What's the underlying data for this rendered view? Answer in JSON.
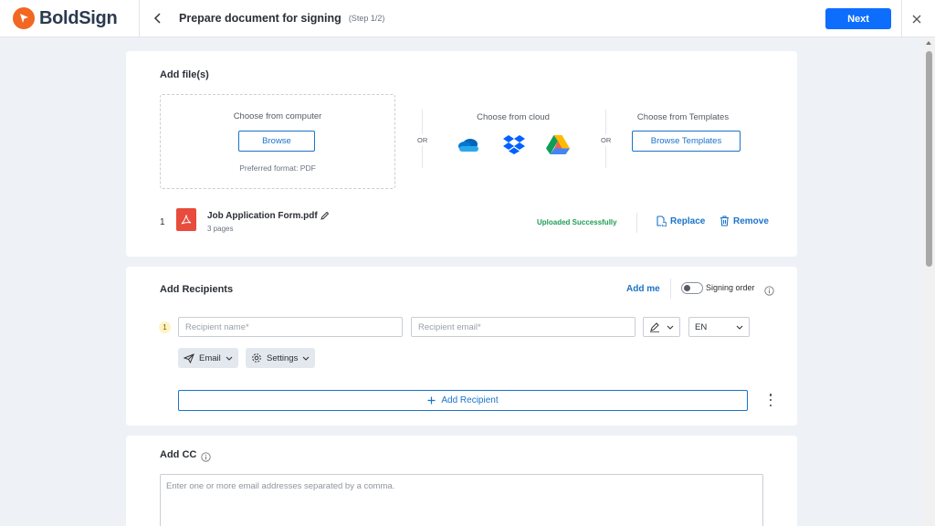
{
  "app": {
    "name": "BoldSign",
    "brand_color": "#f26722",
    "accent_color": "#1a73c9"
  },
  "header": {
    "title": "Prepare document for signing",
    "step": "(Step 1/2)",
    "next_label": "Next"
  },
  "add_files": {
    "title": "Add file(s)",
    "computer": {
      "label": "Choose from computer",
      "button": "Browse",
      "format": "Preferred format: PDF"
    },
    "or_label": "OR",
    "cloud": {
      "label": "Choose from cloud",
      "icons": [
        "onedrive-icon",
        "dropbox-icon",
        "google-drive-icon"
      ]
    },
    "templates": {
      "label": "Choose from Templates",
      "button": "Browse Templates"
    },
    "file": {
      "index": "1",
      "name": "Job Application Form.pdf",
      "pages": "3 pages",
      "status": "Uploaded Successfully",
      "replace_label": "Replace",
      "remove_label": "Remove"
    }
  },
  "recipients": {
    "title": "Add Recipients",
    "add_me": "Add me",
    "signing_order": "Signing order",
    "signing_order_enabled": false,
    "rows": [
      {
        "number": "1",
        "name_placeholder": "Recipient name*",
        "email_placeholder": "Recipient email*",
        "language": "EN",
        "email_label": "Email",
        "settings_label": "Settings"
      }
    ],
    "add_recipient_label": "Add Recipient"
  },
  "cc": {
    "title": "Add CC",
    "placeholder": "Enter one or more email addresses separated by a comma."
  }
}
